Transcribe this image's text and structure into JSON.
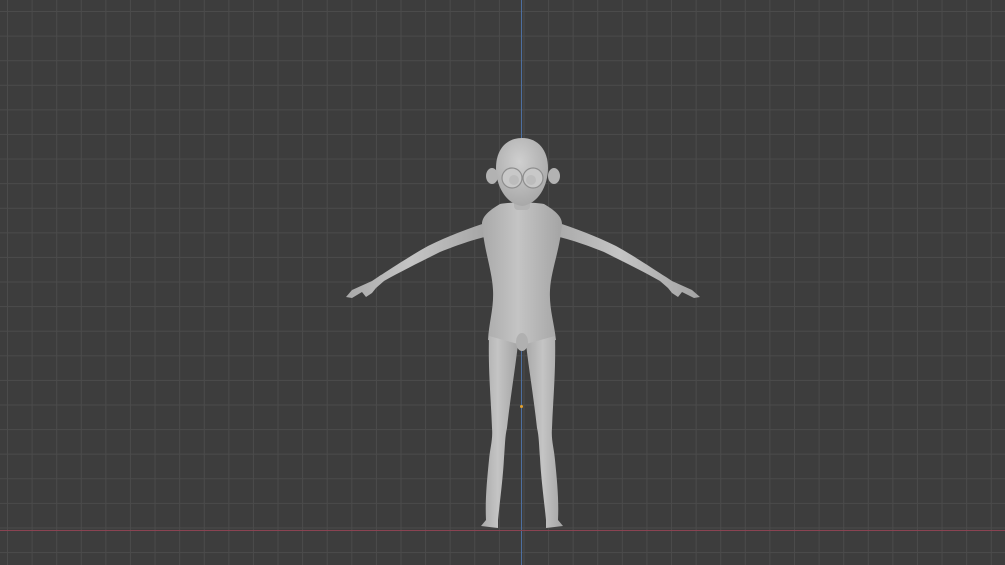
{
  "viewport": {
    "background_color": "#3d3d3d",
    "grid_color": "#4b4b4b",
    "z_axis_color": "#4d6fa0",
    "x_axis_color": "#8a4352",
    "model_color": "#bdbdbd",
    "origin_color": "#e0a030"
  },
  "model": {
    "pose": "T-pose",
    "shading": "solid"
  }
}
